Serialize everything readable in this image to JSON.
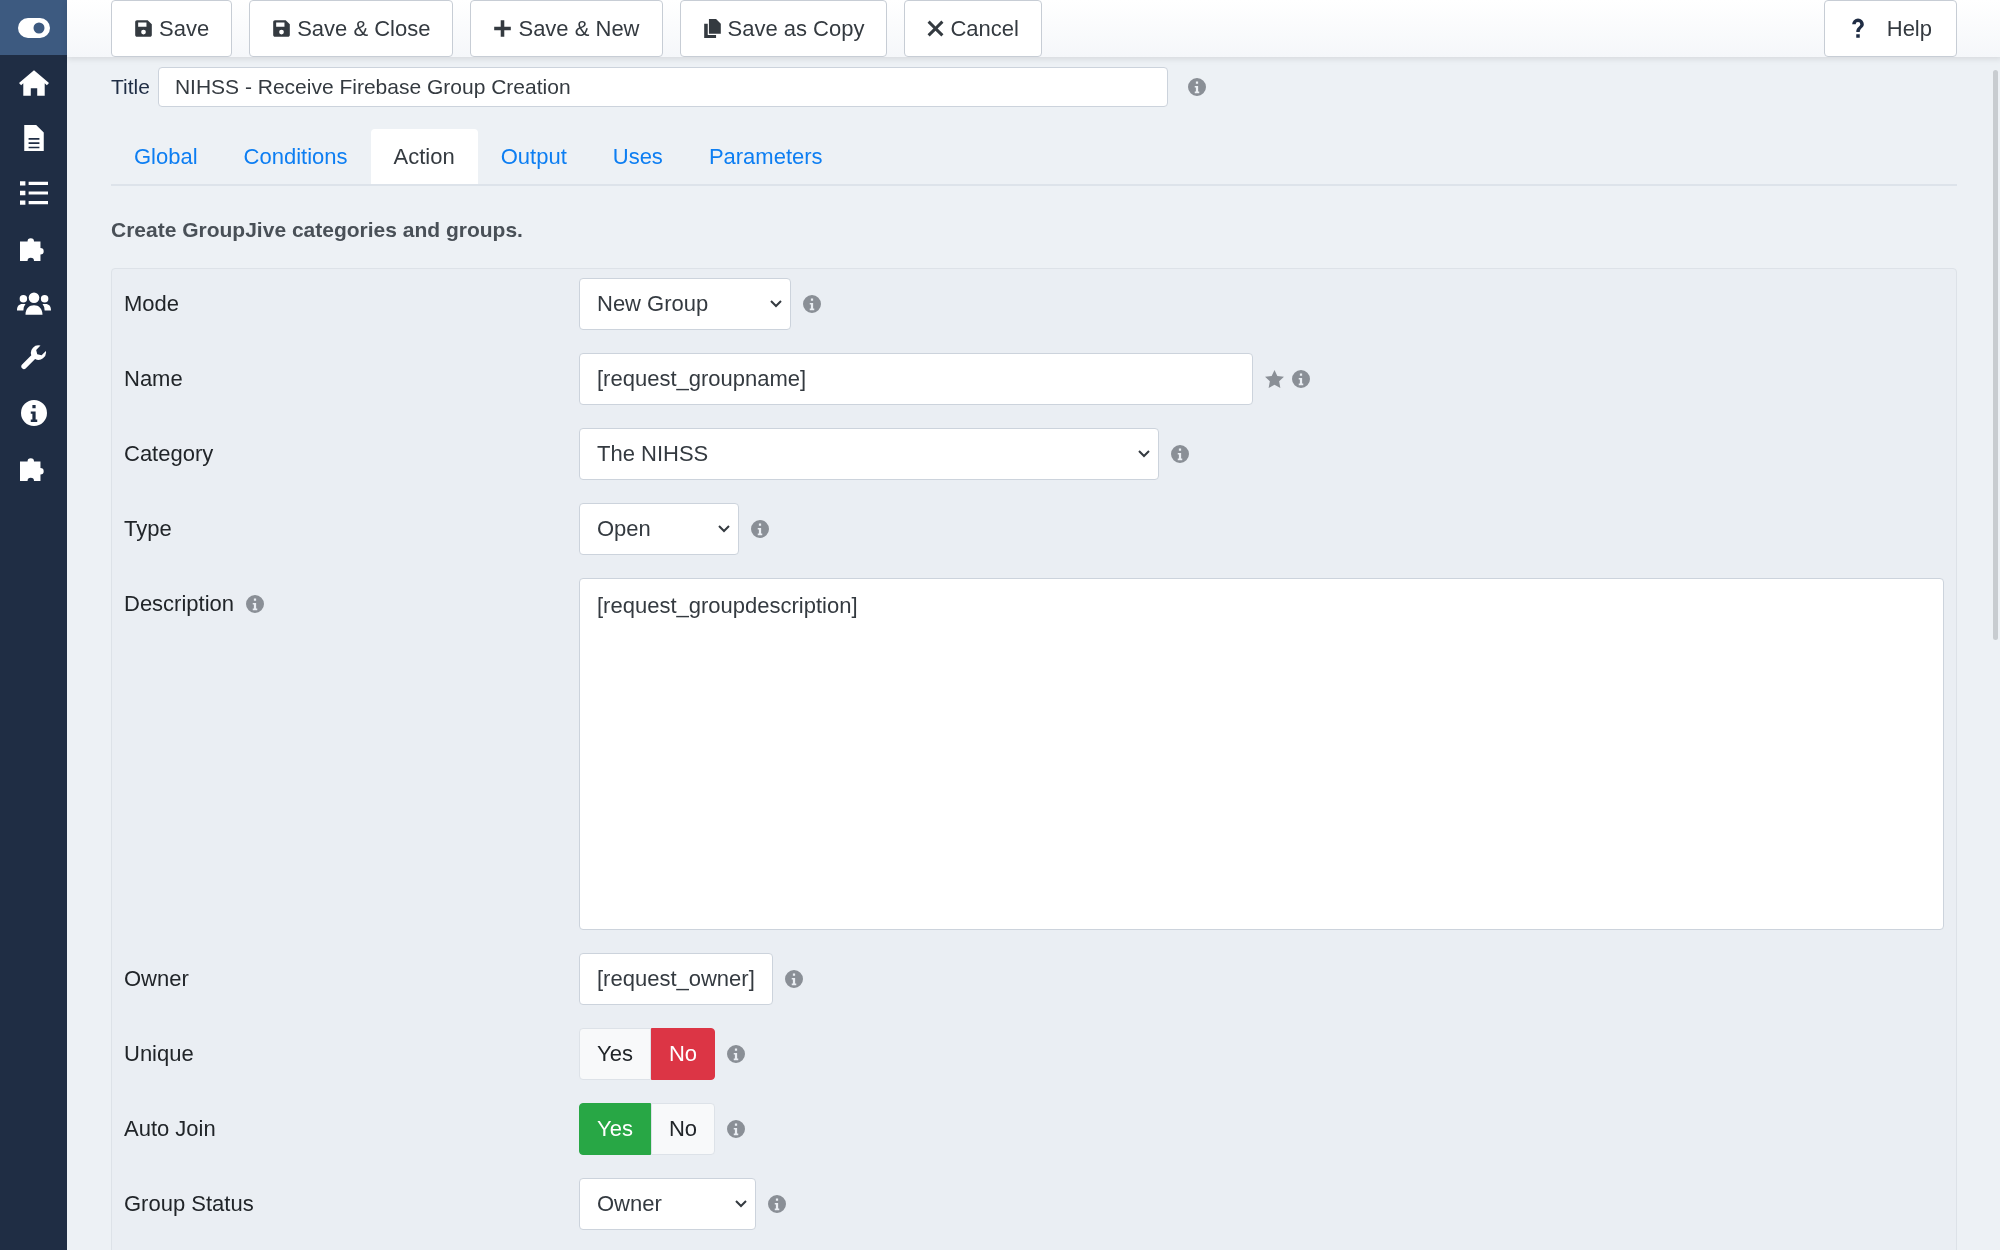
{
  "sidebar": {
    "items": [
      {
        "selected": true
      },
      {
        "selected": false
      },
      {
        "selected": false
      },
      {
        "selected": false
      },
      {
        "selected": false
      },
      {
        "selected": false
      },
      {
        "selected": false
      },
      {
        "selected": false
      },
      {
        "selected": false
      }
    ]
  },
  "toolbar": {
    "buttons": [
      {
        "label": "Save"
      },
      {
        "label": "Save & Close"
      },
      {
        "label": "Save & New"
      },
      {
        "label": "Save as Copy"
      },
      {
        "label": "Cancel"
      }
    ],
    "help": "Help"
  },
  "title_field": {
    "label": "Title",
    "value": "NIHSS - Receive Firebase Group Creation"
  },
  "tabs": [
    {
      "label": "Global",
      "selected": false
    },
    {
      "label": "Conditions",
      "selected": false
    },
    {
      "label": "Action",
      "selected": true
    },
    {
      "label": "Output",
      "selected": false
    },
    {
      "label": "Uses",
      "selected": false
    },
    {
      "label": "Parameters",
      "selected": false
    }
  ],
  "description": "Create GroupJive categories and groups.",
  "form": {
    "rows": [
      {
        "label": "Mode",
        "kind": "select",
        "value": "New Group"
      },
      {
        "label": "Name",
        "kind": "input",
        "value": "[request_groupname]",
        "required": true
      },
      {
        "label": "Category",
        "kind": "select",
        "value": "The NIHSS"
      },
      {
        "label": "Type",
        "kind": "select",
        "value": "Open"
      },
      {
        "label": "Description",
        "kind": "textarea",
        "value": "[request_groupdescription]",
        "label_info": true
      },
      {
        "label": "Owner",
        "kind": "input",
        "value": "[request_owner]"
      },
      {
        "label": "Unique",
        "kind": "toggle",
        "options": [
          {
            "label": "Yes",
            "kind": "yes",
            "selected": false
          },
          {
            "label": "No",
            "kind": "no",
            "selected": true
          }
        ]
      },
      {
        "label": "Auto Join",
        "kind": "toggle",
        "options": [
          {
            "label": "Yes",
            "kind": "yes",
            "selected": true
          },
          {
            "label": "No",
            "kind": "no",
            "selected": false
          }
        ]
      },
      {
        "label": "Group Status",
        "kind": "select",
        "value": "Owner"
      }
    ]
  }
}
